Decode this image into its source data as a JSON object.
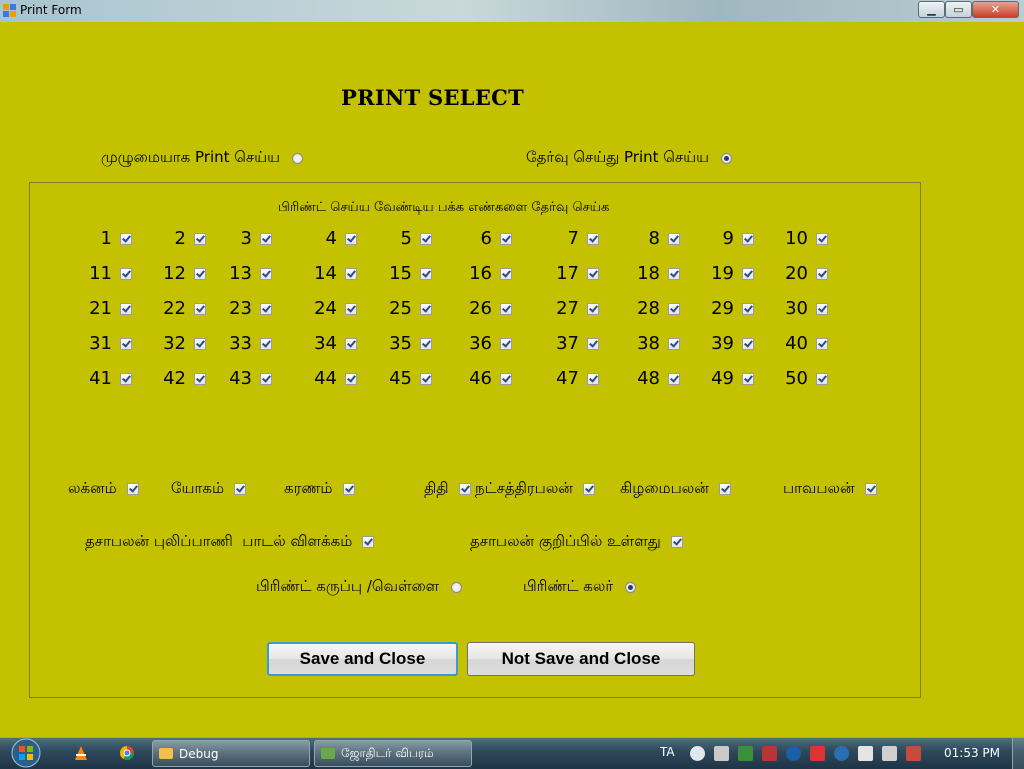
{
  "window": {
    "title": "Print Form"
  },
  "form": {
    "heading": "PRINT SELECT",
    "radio_full": {
      "label": "முழுமையாக Print செய்ய",
      "selected": false
    },
    "radio_select": {
      "label": "தேர்வு செய்து Print செய்ய",
      "selected": true
    },
    "group_caption": "பிரிண்ட் செய்ய வேண்டிய பக்க எண்களை தேர்வு செய்க",
    "pages": [
      "1",
      "2",
      "3",
      "4",
      "5",
      "6",
      "7",
      "8",
      "9",
      "10",
      "11",
      "12",
      "13",
      "14",
      "15",
      "16",
      "17",
      "18",
      "19",
      "20",
      "21",
      "22",
      "23",
      "24",
      "25",
      "26",
      "27",
      "28",
      "29",
      "30",
      "31",
      "32",
      "33",
      "34",
      "35",
      "36",
      "37",
      "38",
      "39",
      "40",
      "41",
      "42",
      "43",
      "44",
      "45",
      "46",
      "47",
      "48",
      "49",
      "50"
    ],
    "options_row1": [
      "லக்னம்",
      "யோகம்",
      "கரணம்",
      "திதி",
      "நட்சத்திரபலன்",
      "கிழமைபலன்",
      "பாவபலன்"
    ],
    "options_row2": [
      "தசாபலன் புலிப்பாணி  பாடல் விளக்கம்",
      "தசாபலன் குறிப்பில் உள்ளது"
    ],
    "print_bw": {
      "label": "பிரிண்ட் கருப்பு /வெள்ளை",
      "selected": false
    },
    "print_color": {
      "label": "பிரிண்ட் கலர்",
      "selected": true
    },
    "save_button": "Save and Close",
    "nosave_button": "Not Save and Close"
  },
  "taskbar": {
    "tasks": [
      "Debug",
      "ஜோதிடர் விபரம்"
    ],
    "language": "TA",
    "time": "01:53 PM"
  },
  "colors": {
    "form_background": "#c3c100",
    "check_mark": "#2a4d86",
    "focus_border": "#3c9ad0"
  }
}
